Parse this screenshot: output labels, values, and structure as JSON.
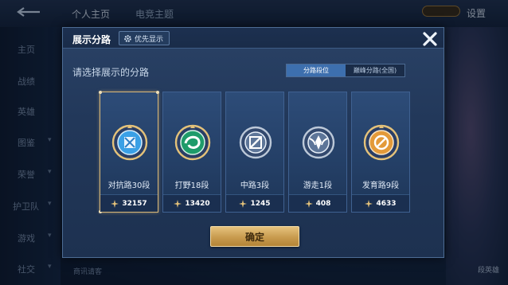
{
  "background": {
    "tabs": [
      "个人主页",
      "电竞主题"
    ],
    "settings_label": "设置",
    "sidebar": [
      {
        "label": "主页"
      },
      {
        "label": "战绩"
      },
      {
        "label": "英雄"
      },
      {
        "label": "图鉴"
      },
      {
        "label": "荣誉"
      },
      {
        "label": "护卫队"
      },
      {
        "label": "游戏"
      },
      {
        "label": "社交"
      }
    ],
    "right_label": "段英雄",
    "bottom_text": "商讯请客"
  },
  "dialog": {
    "title": "展示分路",
    "priority_label": "优先显示",
    "prompt": "请选择展示的分路",
    "toggle": {
      "options": [
        "分路段位",
        "巅峰分路(全国)"
      ],
      "active_index": 0
    },
    "cards": [
      {
        "label": "对抗路30段",
        "score": "32157",
        "selected": true,
        "badge": "blue-shield"
      },
      {
        "label": "打野18段",
        "score": "13420",
        "selected": false,
        "badge": "green-swirl"
      },
      {
        "label": "中路3段",
        "score": "1245",
        "selected": false,
        "badge": "silver-slash"
      },
      {
        "label": "游走1段",
        "score": "408",
        "selected": false,
        "badge": "silver-wings"
      },
      {
        "label": "发育路9段",
        "score": "4633",
        "selected": false,
        "badge": "gold-bow"
      }
    ],
    "confirm_label": "确定"
  },
  "colors": {
    "accent_gold": "#d9b878",
    "toggle_active": "#3d6fae",
    "panel_bg": "#22385a"
  }
}
